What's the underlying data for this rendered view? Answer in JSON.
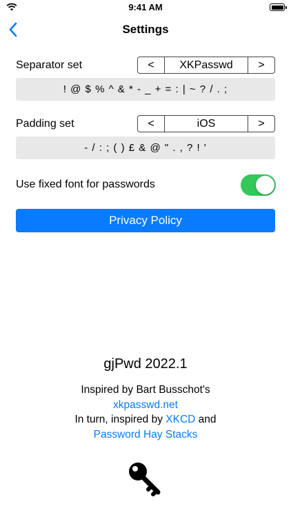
{
  "status_bar": {
    "time": "9:41 AM"
  },
  "nav": {
    "title": "Settings"
  },
  "separator": {
    "label": "Separator set",
    "prev": "<",
    "next": ">",
    "value": "XKPasswd",
    "chars": "! @ $ % ^ & * - _ + = : | ~ ? / . ;"
  },
  "padding": {
    "label": "Padding set",
    "prev": "<",
    "next": ">",
    "value": "iOS",
    "chars": "- / : ; ( ) £ & @ \" . , ? ! '"
  },
  "fixed_font": {
    "label": "Use fixed font for passwords",
    "enabled": true
  },
  "privacy_button": "Privacy Policy",
  "about": {
    "app_name": "gjPwd 2022.1",
    "inspired_line": "Inspired by Bart Busschot's",
    "link_xkpasswd": "xkpasswd.net",
    "turn_prefix": "In turn, inspired by ",
    "link_xkcd": "XKCD",
    "turn_suffix": " and",
    "link_haystacks": "Password Hay Stacks"
  },
  "colors": {
    "accent": "#0a7aff",
    "toggle_on": "#34c759",
    "char_box": "#e8e8e9"
  },
  "icons": [
    "wifi-icon",
    "battery-icon",
    "back-chevron-icon",
    "key-icon"
  ]
}
